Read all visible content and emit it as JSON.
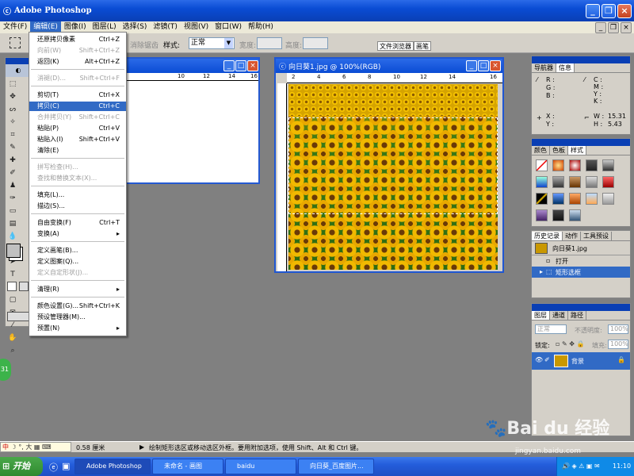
{
  "app": {
    "title": "Adobe Photoshop"
  },
  "menubar": {
    "items": [
      {
        "label": "文件(F)"
      },
      {
        "label": "编辑(E)"
      },
      {
        "label": "图像(I)"
      },
      {
        "label": "图层(L)"
      },
      {
        "label": "选择(S)"
      },
      {
        "label": "滤镜(T)"
      },
      {
        "label": "视图(V)"
      },
      {
        "label": "窗口(W)"
      },
      {
        "label": "帮助(H)"
      }
    ]
  },
  "options": {
    "feather_label": "消除锯齿",
    "style_label": "样式:",
    "style_value": "正常",
    "width_label": "宽度:",
    "height_label": "高度:",
    "file_browser_tab": "文件浏览器",
    "brushes_tab": "画笔"
  },
  "edit_menu": {
    "items": [
      {
        "label": "还原拷贝像素",
        "key": "Ctrl+Z",
        "disabled": false
      },
      {
        "label": "向前(W)",
        "key": "Shift+Ctrl+Z",
        "disabled": true
      },
      {
        "label": "返回(K)",
        "key": "Alt+Ctrl+Z",
        "disabled": false
      },
      {
        "label": "消褪(D)...",
        "key": "Shift+Ctrl+F",
        "disabled": true
      },
      {
        "label": "剪切(T)",
        "key": "Ctrl+X",
        "disabled": false
      },
      {
        "label": "拷贝(C)",
        "key": "Ctrl+C",
        "disabled": false,
        "highlighted": true
      },
      {
        "label": "合并拷贝(Y)",
        "key": "Shift+Ctrl+C",
        "disabled": true
      },
      {
        "label": "粘贴(P)",
        "key": "Ctrl+V",
        "disabled": false
      },
      {
        "label": "粘贴入(I)",
        "key": "Shift+Ctrl+V",
        "disabled": false
      },
      {
        "label": "清除(E)",
        "key": "",
        "disabled": false
      },
      {
        "label": "拼写检查(H)...",
        "key": "",
        "disabled": true
      },
      {
        "label": "查找和替换文本(X)...",
        "key": "",
        "disabled": true
      },
      {
        "label": "填充(L)...",
        "key": "",
        "disabled": false
      },
      {
        "label": "描边(S)...",
        "key": "",
        "disabled": false
      },
      {
        "label": "自由变换(F)",
        "key": "Ctrl+T",
        "disabled": false
      },
      {
        "label": "变换(A)",
        "key": "▸",
        "disabled": false
      },
      {
        "label": "定义画笔(B)...",
        "key": "",
        "disabled": false
      },
      {
        "label": "定义图案(Q)...",
        "key": "",
        "disabled": false
      },
      {
        "label": "定义自定形状(J)...",
        "key": "",
        "disabled": true
      },
      {
        "label": "清理(R)",
        "key": "▸",
        "disabled": false
      },
      {
        "label": "颜色设置(G)...",
        "key": "Shift+Ctrl+K",
        "disabled": false
      },
      {
        "label": "预设管理器(M)...",
        "key": "",
        "disabled": false
      },
      {
        "label": "预置(N)",
        "key": "▸",
        "disabled": false
      }
    ]
  },
  "image_window": {
    "title": "向日葵1.jpg @ 100%(RGB)"
  },
  "ruler": {
    "ticks": [
      "2",
      "4",
      "6",
      "8",
      "10",
      "12",
      "14",
      "16"
    ],
    "untitled_ticks": [
      "10",
      "12",
      "14",
      "16"
    ]
  },
  "navigator": {
    "tabs": [
      "导航器",
      "信息"
    ],
    "r": "R :",
    "g": "G :",
    "b": "B :",
    "c": "C :",
    "m": "M :",
    "y": "Y :",
    "k": "K :",
    "x": "X :",
    "y2": "Y :",
    "w_label": "W :",
    "h_label": "H :",
    "w": "15.31",
    "h": "5.43"
  },
  "color_palette": {
    "tabs": [
      "颜色",
      "色板",
      "样式"
    ]
  },
  "history": {
    "tabs": [
      "历史记录",
      "动作",
      "工具预设"
    ],
    "snapshot": "向日葵1.jpg",
    "steps": [
      "打开",
      "矩形选框"
    ]
  },
  "layers": {
    "tabs": [
      "图层",
      "通道",
      "路径"
    ],
    "blend_mode": "正常",
    "opacity_label": "不透明度:",
    "opacity": "100%",
    "lock_label": "锁定:",
    "fill_label": "填充:",
    "fill": "100%",
    "layer_name": "背景"
  },
  "status": {
    "zoom": "0.58 厘米",
    "message": "绘制矩形选区或移动选区外框。要用附加选项，使用 Shift、Alt 和 Ctrl 键。"
  },
  "ime": {
    "text": "中",
    "badge": "31"
  },
  "taskbar": {
    "start": "开始",
    "tasks": [
      "Adobe Photoshop",
      "未命名 - 画图",
      "baidu",
      "向日葵_百度图片..."
    ],
    "clock": "11:10"
  },
  "watermark": {
    "brand": "Bai du 经验",
    "url": "jingyan.baidu.com"
  }
}
